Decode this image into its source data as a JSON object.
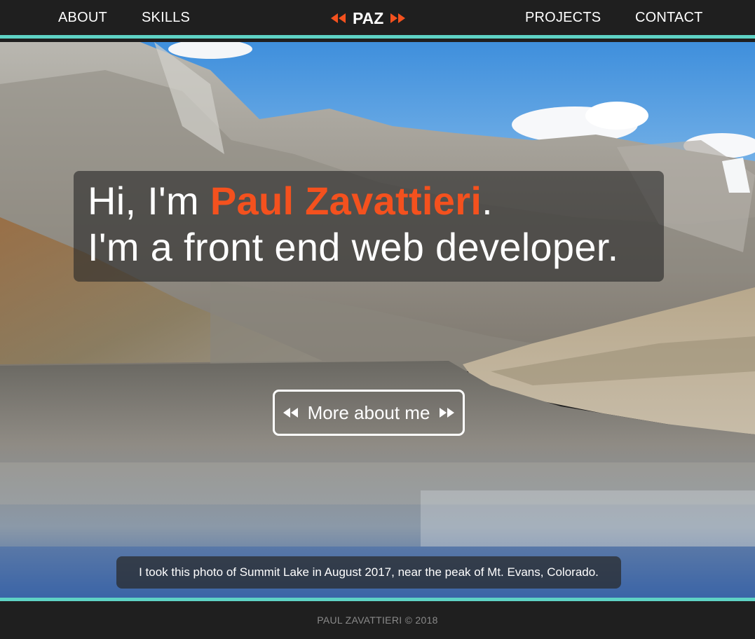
{
  "nav": {
    "about": "ABOUT",
    "skills": "SKILLS",
    "brand": "PAZ",
    "projects": "PROJECTS",
    "contact": "CONTACT",
    "brand_icons": [
      "rewind-icon",
      "fast-forward-icon"
    ]
  },
  "hero": {
    "greeting_prefix": "Hi, I'm ",
    "name": "Paul Zavattieri",
    "greeting_suffix": ".",
    "tagline": "I'm a front end web developer.",
    "cta_label": "More about me",
    "cta_icons": [
      "rewind-icon",
      "fast-forward-icon"
    ],
    "caption": "I took this photo of Summit Lake in August 2017, near the peak of Mt. Evans, Colorado."
  },
  "footer": {
    "copyright": "PAUL ZAVATTIERI © 2018"
  },
  "colors": {
    "accent": "#f4511e",
    "border_teal": "#5ed2c5",
    "nav_bg": "#1f1f1f",
    "footer_text": "#8a8a8a"
  }
}
